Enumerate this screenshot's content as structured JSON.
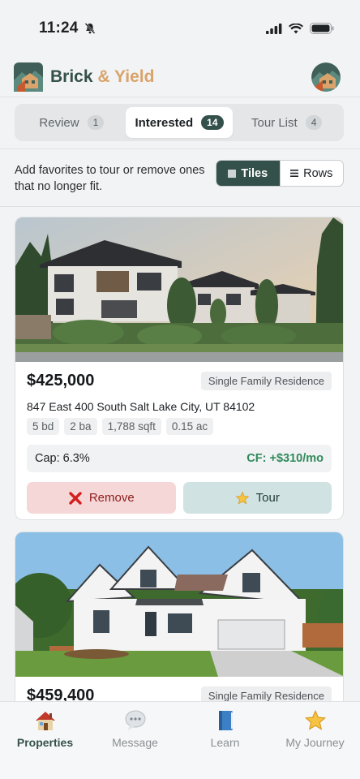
{
  "status_bar": {
    "time": "11:24"
  },
  "app": {
    "brand_part1": "Brick",
    "brand_part2": "&",
    "brand_part3": "Yield"
  },
  "tabs": [
    {
      "label": "Review",
      "count": "1"
    },
    {
      "label": "Interested",
      "count": "14"
    },
    {
      "label": "Tour List",
      "count": "4"
    }
  ],
  "helper_text": "Add favorites to tour or remove ones that no longer fit.",
  "view_toggle": {
    "tiles_label": "Tiles",
    "rows_label": "Rows"
  },
  "listings": [
    {
      "price": "$425,000",
      "type": "Single Family Residence",
      "address": "847 East 400 South Salt Lake City, UT 84102",
      "beds": "5 bd",
      "baths": "2 ba",
      "sqft": "1,788 sqft",
      "lot": "0.15 ac",
      "cap": "Cap: 6.3%",
      "cf": "CF: +$310/mo",
      "remove_label": "Remove",
      "tour_label": "Tour"
    },
    {
      "price": "$459,400",
      "type": "Single Family Residence"
    }
  ],
  "bottom_nav": [
    {
      "label": "Properties",
      "icon": "house-icon"
    },
    {
      "label": "Message",
      "icon": "speech-bubble-icon"
    },
    {
      "label": "Learn",
      "icon": "book-icon"
    },
    {
      "label": "My Journey",
      "icon": "star-icon"
    }
  ],
  "colors": {
    "brand_green": "#34504b",
    "brand_gold": "#d9a36b",
    "positive": "#2f8a5b",
    "danger": "#8e1c1c"
  }
}
